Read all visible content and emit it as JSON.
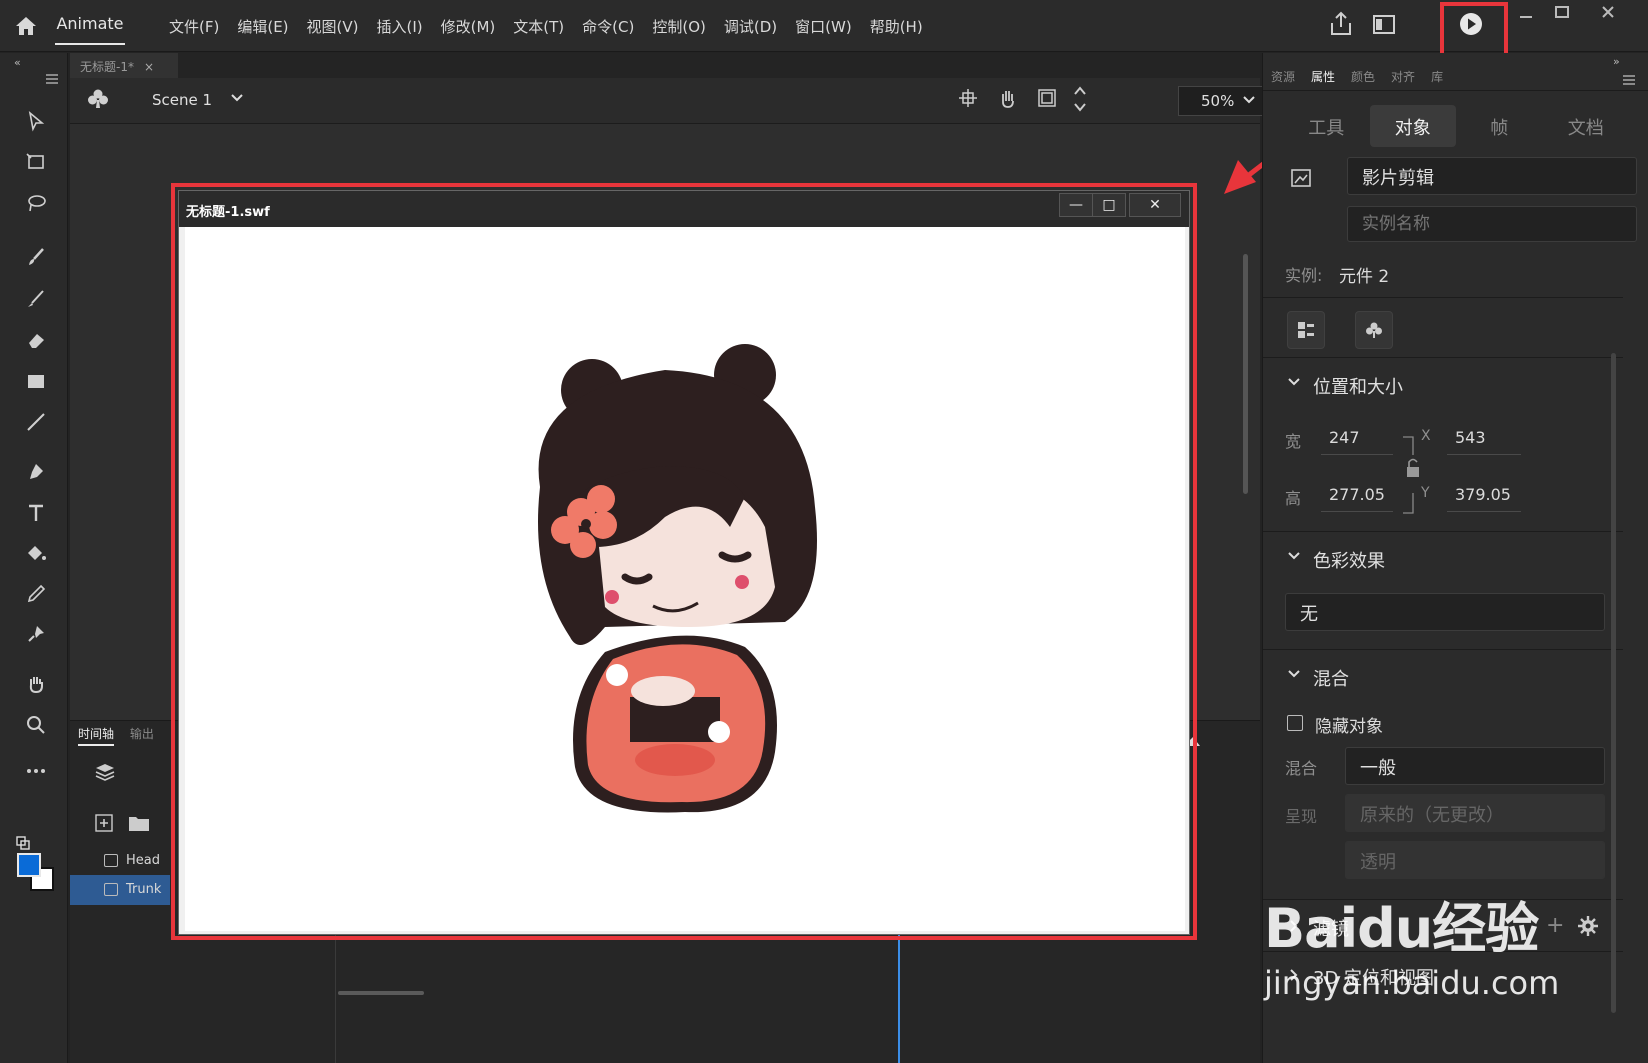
{
  "app": {
    "name": "Animate",
    "menus": [
      "文件(F)",
      "编辑(E)",
      "视图(V)",
      "插入(I)",
      "修改(M)",
      "文本(T)",
      "命令(C)",
      "控制(O)",
      "调试(D)",
      "窗口(W)",
      "帮助(H)"
    ]
  },
  "document": {
    "tab_label": "无标题-1*",
    "scene": "Scene 1",
    "zoom": "50%"
  },
  "swf_window": {
    "title": "无标题-1.swf"
  },
  "timeline": {
    "tabs": [
      "时间轴",
      "输出"
    ],
    "layers": [
      {
        "name": "Head",
        "selected": false
      },
      {
        "name": "Trunk",
        "selected": true
      }
    ]
  },
  "properties": {
    "tabs": [
      "资源",
      "属性",
      "颜色",
      "对齐",
      "库"
    ],
    "active_tab": "属性",
    "segments": [
      "工具",
      "对象",
      "帧",
      "文档"
    ],
    "active_segment": "对象",
    "symbol_type": "影片剪辑",
    "instance_name_placeholder": "实例名称",
    "instance_label": "实例:",
    "instance_value": "元件 2",
    "position_size": {
      "title": "位置和大小",
      "width_label": "宽",
      "width": "247",
      "height_label": "高",
      "height": "277.05",
      "x_label": "X",
      "x": "543",
      "y_label": "Y",
      "y": "379.05"
    },
    "color_effect": {
      "title": "色彩效果",
      "value": "无"
    },
    "blend": {
      "title": "混合",
      "hide_object": "隐藏对象",
      "blend_label": "混合",
      "blend_value": "一般",
      "render_label": "呈现",
      "render_value": "原来的（无更改）",
      "transparent": "透明"
    },
    "filters_title": "滤镜",
    "three_d_title": "3D 定位和视图"
  },
  "watermark": {
    "brand": "Baidu经验",
    "url": "jingyan.baidu.com"
  },
  "colors": {
    "accent_red": "#e8353b",
    "fill_color": "#0a6bd7",
    "selected_layer": "#2e5b93"
  }
}
